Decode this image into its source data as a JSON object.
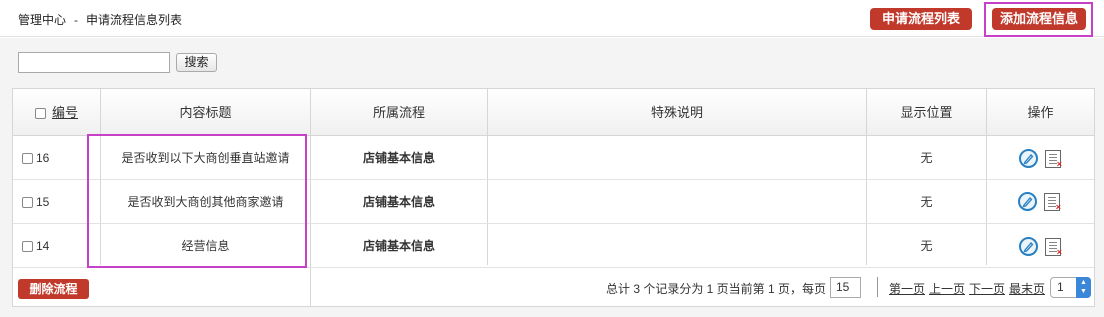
{
  "header": {
    "breadcrumb_root": "管理中心",
    "breadcrumb_sep": "-",
    "breadcrumb_page": "申请流程信息列表",
    "list_button": "申请流程列表",
    "add_button": "添加流程信息"
  },
  "search": {
    "input_value": "",
    "button_label": "搜索"
  },
  "table": {
    "columns": {
      "id": "编号",
      "title": "内容标题",
      "flow": "所属流程",
      "note": "特殊说明",
      "position": "显示位置",
      "action": "操作"
    },
    "rows": [
      {
        "id": "16",
        "title": "是否收到以下大商创垂直站邀请",
        "flow": "店铺基本信息",
        "note": "",
        "position": "无"
      },
      {
        "id": "15",
        "title": "是否收到大商创其他商家邀请",
        "flow": "店铺基本信息",
        "note": "",
        "position": "无"
      },
      {
        "id": "14",
        "title": "经营信息",
        "flow": "店铺基本信息",
        "note": "",
        "position": "无"
      }
    ]
  },
  "footer": {
    "delete_button": "删除流程",
    "pager_text": "总计 3 个记录分为 1 页当前第 1 页，每页",
    "page_size": "15",
    "first": "第一页",
    "prev": "上一页",
    "next": "下一页",
    "last": "最末页",
    "page_select": "1"
  },
  "icons": {
    "edit": "edit-pencil-icon",
    "delete": "delete-document-icon"
  },
  "colors": {
    "button_red": "#c0392b",
    "highlight": "#c640c8",
    "edit_blue": "#2a7fc1"
  }
}
